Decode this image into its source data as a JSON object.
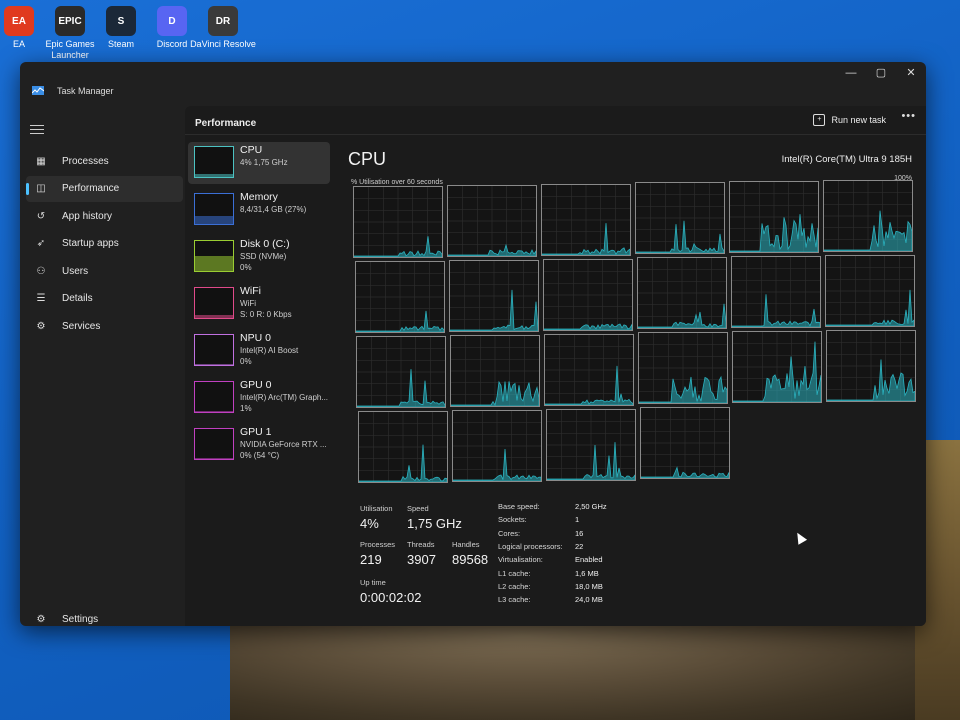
{
  "desktop": {
    "icons": [
      {
        "label": "EA",
        "color": "#e03a1e",
        "glyph": "EA"
      },
      {
        "label": "Epic Games Launcher",
        "color": "#2a2a2a",
        "glyph": "EPIC"
      },
      {
        "label": "Steam",
        "color": "#1b2838",
        "glyph": "S"
      },
      {
        "label": "Discord",
        "color": "#5865f2",
        "glyph": "D"
      },
      {
        "label": "DaVinci Resolve",
        "color": "#3a3a3a",
        "glyph": "DR"
      }
    ]
  },
  "window": {
    "title": "Task Manager",
    "controls": {
      "minimize": "—",
      "maximize": "▢",
      "close": "✕"
    }
  },
  "nav": {
    "items": [
      {
        "label": "Processes",
        "icon": "grid-icon",
        "glyph": "▦"
      },
      {
        "label": "Performance",
        "icon": "chart-icon",
        "glyph": "◫",
        "active": true
      },
      {
        "label": "App history",
        "icon": "history-icon",
        "glyph": "↺"
      },
      {
        "label": "Startup apps",
        "icon": "startup-icon",
        "glyph": "➶"
      },
      {
        "label": "Users",
        "icon": "users-icon",
        "glyph": "⚇"
      },
      {
        "label": "Details",
        "icon": "list-icon",
        "glyph": "☰"
      },
      {
        "label": "Services",
        "icon": "services-icon",
        "glyph": "⚙"
      }
    ],
    "settings": {
      "label": "Settings",
      "glyph": "⚙"
    }
  },
  "header": {
    "title": "Performance",
    "run_new_task": "Run new task",
    "more": "•••"
  },
  "devices": [
    {
      "name": "CPU",
      "sub": "4% 1,75 GHz",
      "sub2": "",
      "color": "#4cc2c2",
      "level": 0.1
    },
    {
      "name": "Memory",
      "sub": "8,4/31,4 GB (27%)",
      "sub2": "",
      "color": "#3b6fd6",
      "level": 0.27
    },
    {
      "name": "Disk 0 (C:)",
      "sub": "SSD (NVMe)",
      "sub2": "0%",
      "color": "#9acd32",
      "level": 0.5
    },
    {
      "name": "WiFi",
      "sub": "WiFi",
      "sub2": "S: 0 R: 0 Kbps",
      "color": "#e04a8a",
      "level": 0.1
    },
    {
      "name": "NPU 0",
      "sub": "Intel(R) AI Boost",
      "sub2": "0%",
      "color": "#c070e0",
      "level": 0
    },
    {
      "name": "GPU 0",
      "sub": "Intel(R) Arc(TM) Graph...",
      "sub2": "1%",
      "color": "#c040c0",
      "level": 0.05
    },
    {
      "name": "GPU 1",
      "sub": "NVIDIA GeForce RTX ...",
      "sub2": "0% (54 °C)",
      "color": "#c040c0",
      "level": 0.02
    }
  ],
  "cpu": {
    "title": "CPU",
    "model": "Intel(R) Core(TM) Ultra 9 185H",
    "util_label": "% Utilisation over 60 seconds",
    "util_max": "100%",
    "graph_color": "#2bb3c0"
  },
  "stats": {
    "utilisation_label": "Utilisation",
    "utilisation": "4%",
    "speed_label": "Speed",
    "speed": "1,75 GHz",
    "processes_label": "Processes",
    "processes": "219",
    "threads_label": "Threads",
    "threads": "3907",
    "handles_label": "Handles",
    "handles": "89568",
    "uptime_label": "Up time",
    "uptime": "0:00:02:02"
  },
  "specs": [
    {
      "k": "Base speed:",
      "v": "2,50 GHz"
    },
    {
      "k": "Sockets:",
      "v": "1"
    },
    {
      "k": "Cores:",
      "v": "16"
    },
    {
      "k": "Logical processors:",
      "v": "22"
    },
    {
      "k": "Virtualisation:",
      "v": "Enabled"
    },
    {
      "k": "L1 cache:",
      "v": "1,6 MB"
    },
    {
      "k": "L2 cache:",
      "v": "18,0 MB"
    },
    {
      "k": "L3 cache:",
      "v": "24,0 MB"
    }
  ]
}
